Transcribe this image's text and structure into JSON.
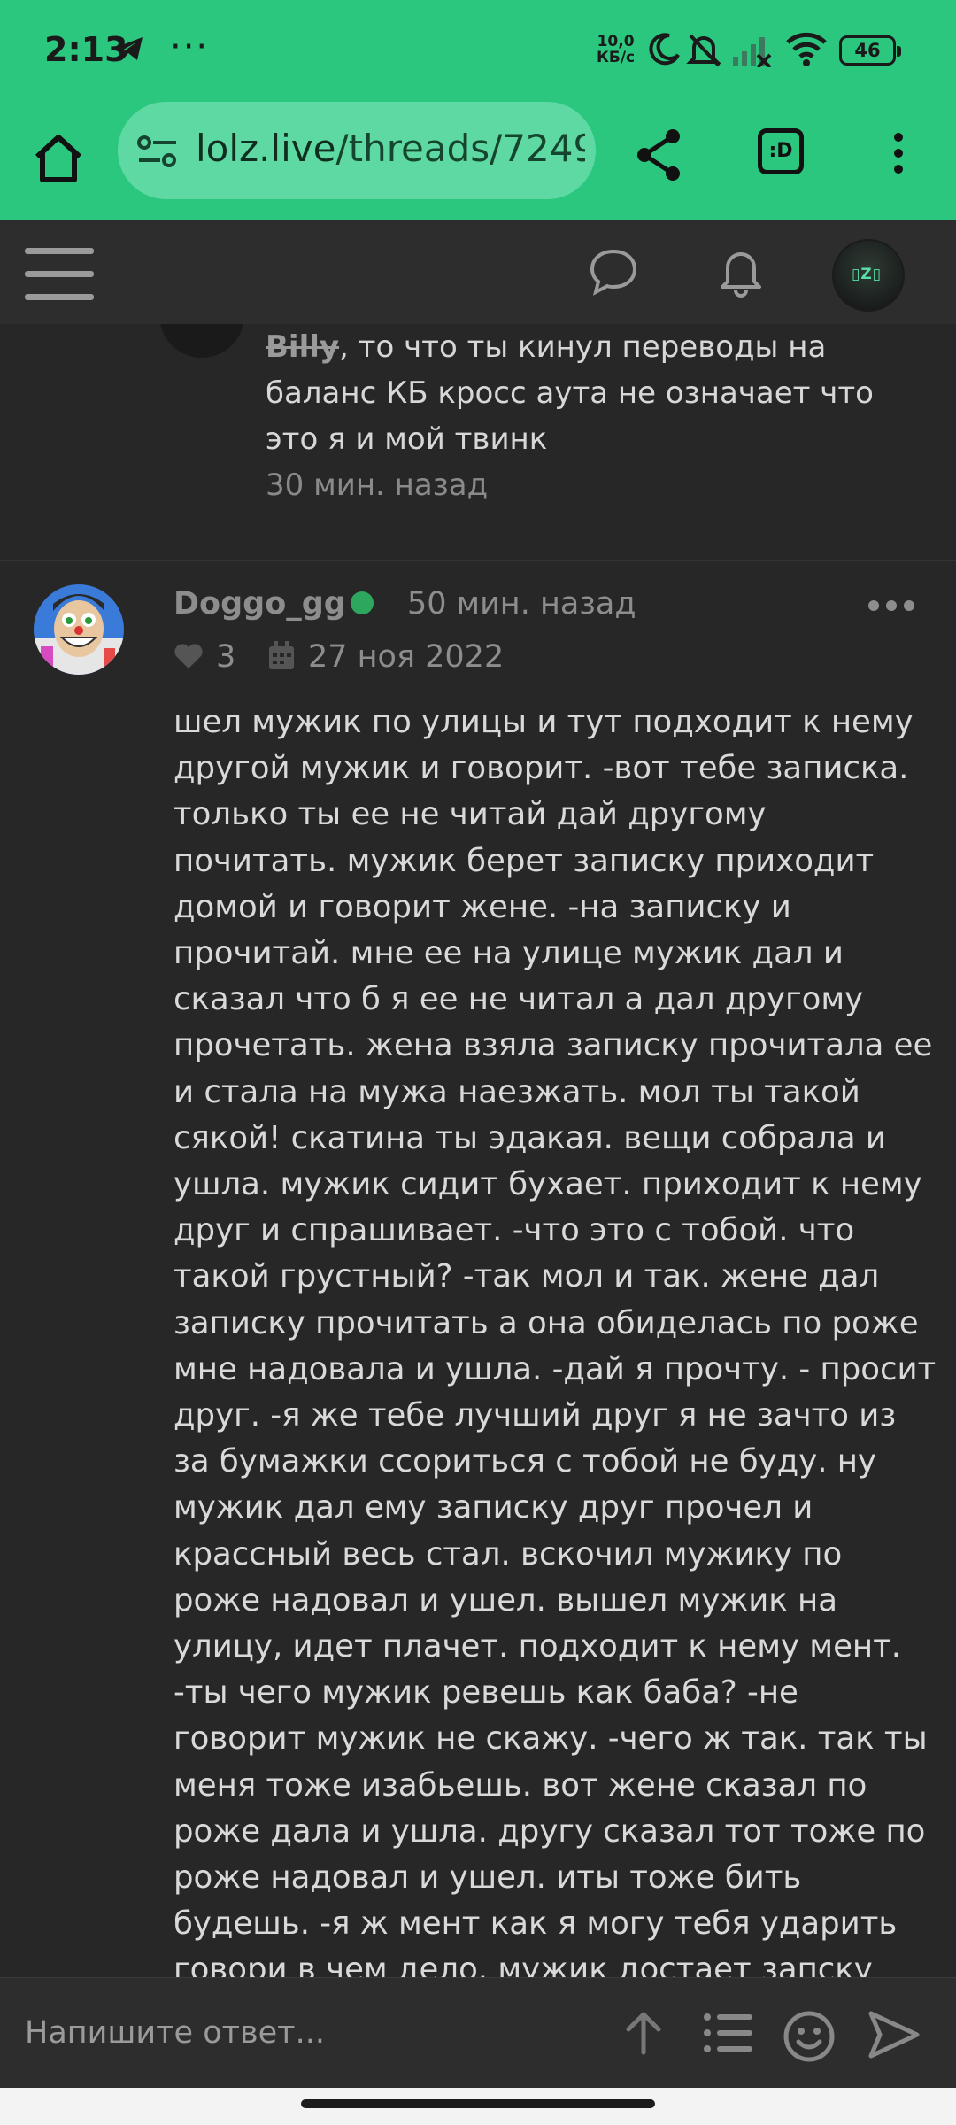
{
  "status": {
    "time": "2:13",
    "overflow": "···",
    "net_speed_top": "10,0",
    "net_speed_bottom": "КБ/с",
    "battery": "46",
    "icons": [
      "telegram-icon",
      "moon-icon",
      "bell-off-icon",
      "signal-icon",
      "wifi-icon",
      "battery-icon"
    ]
  },
  "browser": {
    "url_domain": "lolz.live",
    "url_path": "/threads/7249",
    "ext_label": ":D"
  },
  "reply": {
    "mention": "Billy",
    "text": ", то что ты кинул переводы на баланс КБ кросс аута не означает что это я и мой твинк",
    "time": "30 мин. назад"
  },
  "post": {
    "username": "Doggo_gg",
    "time": "50 мин. назад",
    "likes": "3",
    "reg_date": "27 ноя 2022",
    "body": "шел мужик по улицы и тут подходит к нему другой мужик и говорит. -вот тебе записка. только ты ее не читай дай другому почитать. мужик берет записку приходит домой и говорит жене. -на записку и прочитай. мне ее на улице мужик дал и сказал что б я ее не читал а дал другому прочетать. жена взяла записку прочитала ее и стала на мужа наезжать. мол ты такой сякой! скатина ты эдакая. вещи собрала и ушла. мужик сидит бухает. приходит к нему друг и спрашивает. -что это с тобой. что такой грустный? -так мол и так. жене дал записку прочитать а она обиделась по роже мне надовала и ушла. -дай я прочту. - просит друг. -я же тебе лучший друг я не зачто из за бумажки ссориться с тобой не буду. ну мужик дал ему записку друг прочел и крассный весь стал. вскочил мужику по роже надовал и ушел. вышел мужик на улицу, идет плачет. подходит к нему мент. -ты чего мужик ревешь как баба? -не говорит мужик не скажу. -чего ж так. так ты меня тоже изабьешь. вот жене сказал по роже дала и ушла. другу сказал тот тоже по роже надовал и ушел. иты тоже бить будешь. -я ж мент как я могу тебя ударить говори в чем дело. мужик достает запску дает менту. тот почитал разозлился и начал мужика лупить. достает дубинку и ну по голове. силы не"
  },
  "composer": {
    "placeholder": "Напишите ответ..."
  },
  "colors": {
    "accent": "#2bc77f",
    "background": "#272727",
    "online": "#2da65e"
  }
}
